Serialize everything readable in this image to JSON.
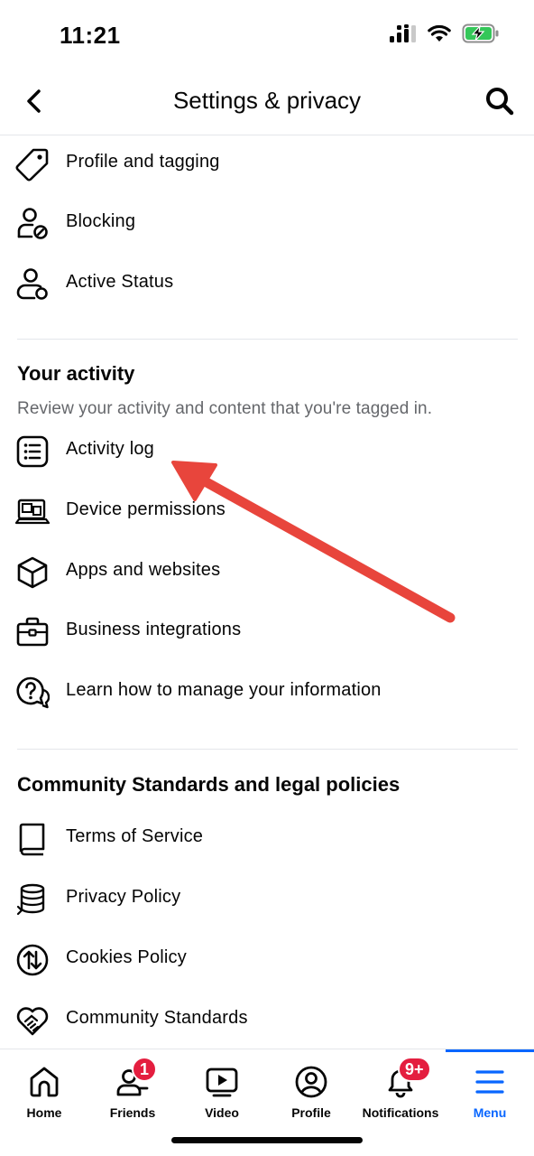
{
  "status_bar": {
    "time": "11:21",
    "icons": [
      "cellular-signal-icon",
      "wifi-icon",
      "battery-charging-icon"
    ],
    "battery_color": "#34c759"
  },
  "header": {
    "title": "Settings & privacy",
    "back_icon": "back-arrow-icon",
    "search_icon": "search-icon"
  },
  "sections": {
    "audience": {
      "items": [
        {
          "label": "Profile and tagging",
          "icon": "tag-icon"
        },
        {
          "label": "Blocking",
          "icon": "person-block-icon"
        },
        {
          "label": "Active Status",
          "icon": "person-status-icon"
        }
      ]
    },
    "your_activity": {
      "title": "Your activity",
      "description": "Review your activity and content that you're tagged in.",
      "items": [
        {
          "label": "Activity log",
          "icon": "list-icon"
        },
        {
          "label": "Device permissions",
          "icon": "devices-icon"
        },
        {
          "label": "Apps and websites",
          "icon": "cube-icon"
        },
        {
          "label": "Business integrations",
          "icon": "briefcase-icon"
        },
        {
          "label": "Learn how to manage your information",
          "icon": "question-bubble-icon"
        }
      ]
    },
    "legal": {
      "title": "Community Standards and legal policies",
      "items": [
        {
          "label": "Terms of Service",
          "icon": "book-icon"
        },
        {
          "label": "Privacy Policy",
          "icon": "database-icon"
        },
        {
          "label": "Cookies Policy",
          "icon": "cookie-arrows-icon"
        },
        {
          "label": "Community Standards",
          "icon": "heart-handshake-icon"
        }
      ]
    }
  },
  "annotation": {
    "icon": "red-arrow-icon",
    "color": "#e8453c"
  },
  "tab_bar": {
    "tabs": [
      {
        "label": "Home",
        "icon": "home-icon",
        "badge": ""
      },
      {
        "label": "Friends",
        "icon": "friends-icon",
        "badge": "1"
      },
      {
        "label": "Video",
        "icon": "video-icon",
        "badge": ""
      },
      {
        "label": "Profile",
        "icon": "profile-icon",
        "badge": ""
      },
      {
        "label": "Notifications",
        "icon": "bell-icon",
        "badge": "9+"
      },
      {
        "label": "Menu",
        "icon": "menu-icon",
        "badge": "",
        "active": true
      }
    ],
    "active_color": "#0866ff",
    "badge_color": "#e41e3f"
  }
}
